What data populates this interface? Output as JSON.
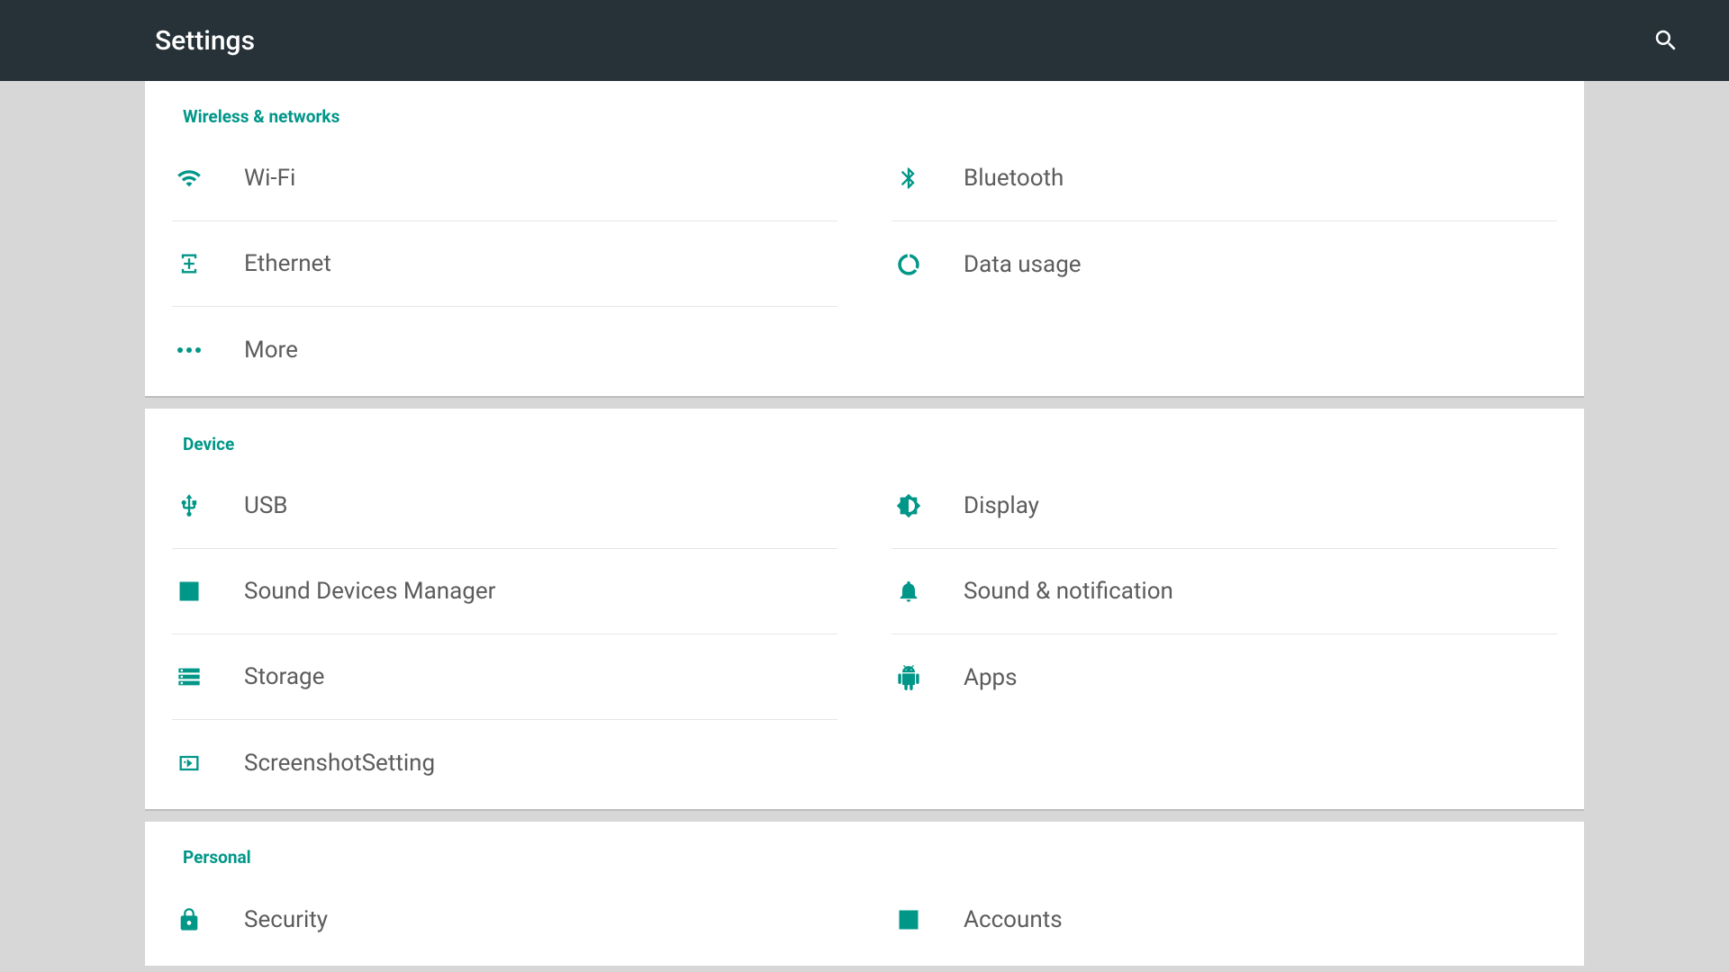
{
  "colors": {
    "accent": "#009688",
    "appbar": "#263238",
    "bg": "#d7d7d7",
    "rowText": "#5c5c5c"
  },
  "appbar": {
    "title": "Settings"
  },
  "sections": {
    "wireless": {
      "header": "Wireless & networks",
      "left": [
        {
          "label": "Wi-Fi",
          "icon": "wifi-icon",
          "name": "setting-wifi"
        },
        {
          "label": "Ethernet",
          "icon": "ethernet-icon",
          "name": "setting-ethernet"
        },
        {
          "label": "More",
          "icon": "more-icon",
          "name": "setting-more"
        }
      ],
      "right": [
        {
          "label": "Bluetooth",
          "icon": "bluetooth-icon",
          "name": "setting-bluetooth"
        },
        {
          "label": "Data usage",
          "icon": "data-usage-icon",
          "name": "setting-data-usage"
        }
      ]
    },
    "device": {
      "header": "Device",
      "left": [
        {
          "label": "USB",
          "icon": "usb-icon",
          "name": "setting-usb"
        },
        {
          "label": "Sound Devices Manager",
          "icon": "equalizer-icon",
          "name": "setting-sound-devices"
        },
        {
          "label": "Storage",
          "icon": "storage-icon",
          "name": "setting-storage"
        },
        {
          "label": "ScreenshotSetting",
          "icon": "screenshot-icon",
          "name": "setting-screenshot"
        }
      ],
      "right": [
        {
          "label": "Display",
          "icon": "display-icon",
          "name": "setting-display"
        },
        {
          "label": "Sound & notification",
          "icon": "bell-icon",
          "name": "setting-sound-notification"
        },
        {
          "label": "Apps",
          "icon": "apps-icon",
          "name": "setting-apps"
        }
      ]
    },
    "personal": {
      "header": "Personal",
      "left": [
        {
          "label": "Security",
          "icon": "lock-icon",
          "name": "setting-security"
        }
      ],
      "right": [
        {
          "label": "Accounts",
          "icon": "account-icon",
          "name": "setting-accounts"
        }
      ]
    }
  }
}
